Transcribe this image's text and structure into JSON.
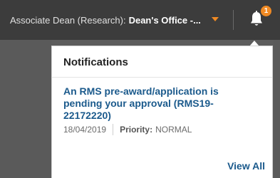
{
  "header": {
    "role_label": "Associate Dean (Research):",
    "role_value": "Dean's Office -...",
    "caret_color": "#f08a24",
    "notification_icon": "bell-icon",
    "notification_count": "1"
  },
  "notifications": {
    "title": "Notifications",
    "items": [
      {
        "title": "An RMS pre-award/application is pending your approval (RMS19-22172220)",
        "date": "18/04/2019",
        "priority_label": "Priority:",
        "priority_value": "NORMAL"
      }
    ],
    "view_all_label": "View All"
  },
  "colors": {
    "header_bg": "#3c3c3c",
    "accent": "#f08a24",
    "link": "#1b5a8c"
  }
}
